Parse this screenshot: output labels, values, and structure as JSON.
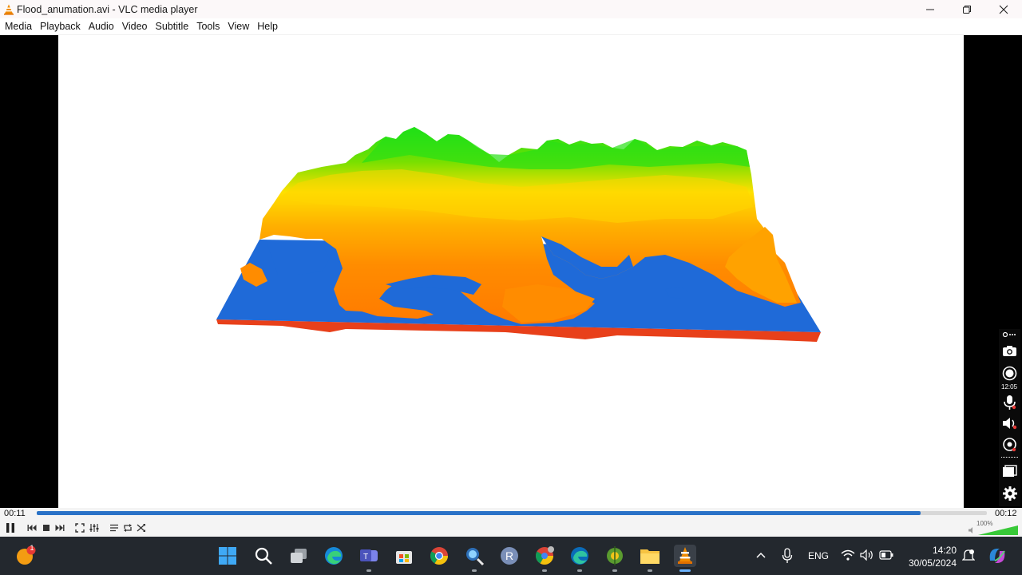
{
  "window": {
    "title": "Flood_anumation.avi - VLC media player",
    "icons": {
      "app": "vlc-cone-icon",
      "minimize": "minimize-icon",
      "maximize": "restore-icon",
      "close": "close-icon"
    }
  },
  "menu": {
    "items": [
      "Media",
      "Playback",
      "Audio",
      "Video",
      "Subtitle",
      "Tools",
      "View",
      "Help"
    ]
  },
  "video": {
    "content": "3d-terrain-flood-render",
    "colors": {
      "water": "#1f6ad8",
      "low": "#ff8c00",
      "mid": "#ffd200",
      "high": "#1ee014",
      "base": "#e8401a"
    }
  },
  "overlay_tools": {
    "time": "12:05",
    "icons": [
      "link-icon",
      "camera-icon",
      "record-icon",
      "microphone-icon",
      "speaker-icon",
      "webcam-icon",
      "window-icon",
      "gear-icon"
    ]
  },
  "player": {
    "elapsed": "00:11",
    "total": "00:12",
    "progress_fraction": 0.93,
    "volume": "100%",
    "volume_fraction": 1.0,
    "accent": "#2a72c7",
    "controls": [
      "pause-icon",
      "previous-icon",
      "stop-icon",
      "next-icon",
      "fullscreen-icon",
      "extended-settings-icon",
      "playlist-icon",
      "loop-icon",
      "shuffle-icon"
    ]
  },
  "taskbar": {
    "notification_badge": "1",
    "apps": [
      "start-icon",
      "search-icon",
      "task-view-icon",
      "edge-icon",
      "teams-icon",
      "store-icon",
      "chrome-icon",
      "magnifier-app-icon",
      "r-icon",
      "chrome-profile-icon",
      "edge-dev-icon",
      "qgis-icon",
      "file-explorer-icon",
      "vlc-taskbar-icon"
    ],
    "lang": "ENG",
    "time": "14:20",
    "date": "30/05/2024"
  }
}
